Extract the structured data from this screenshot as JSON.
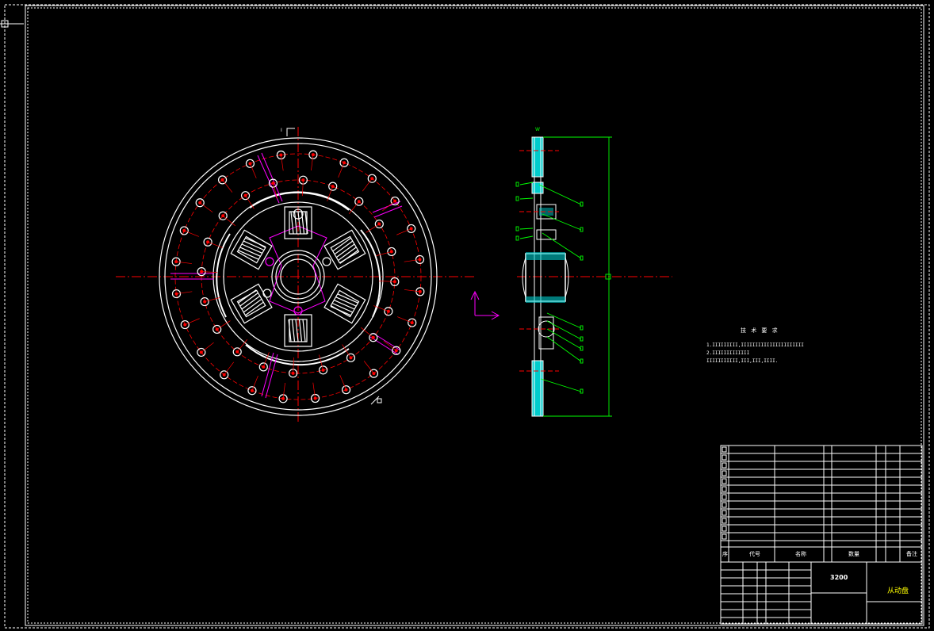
{
  "drawing": {
    "background": "#000000",
    "line_color": "#ffffff",
    "center_line_color": "#ff0000",
    "dimension_color": "#00ff00",
    "hatch_color": "#00ffff",
    "highlight_color": "#ff00ff"
  },
  "technical_requirements": {
    "heading": "技 术 要 求",
    "lines": [
      "1.IIIIIIIII,IIIIIIIIIIIIIIIIIIIIII",
      "2.IIIIIIIIIIIII",
      "IIIIIIIIIII,III,III,IIII."
    ]
  },
  "title_block": {
    "drawing_number": "3200",
    "drawing_name": "从动盘",
    "bom_header": [
      "序",
      "代号",
      "名称",
      "数量",
      "备注"
    ]
  },
  "markers": {
    "top_dim": "I",
    "side_top": "W"
  }
}
